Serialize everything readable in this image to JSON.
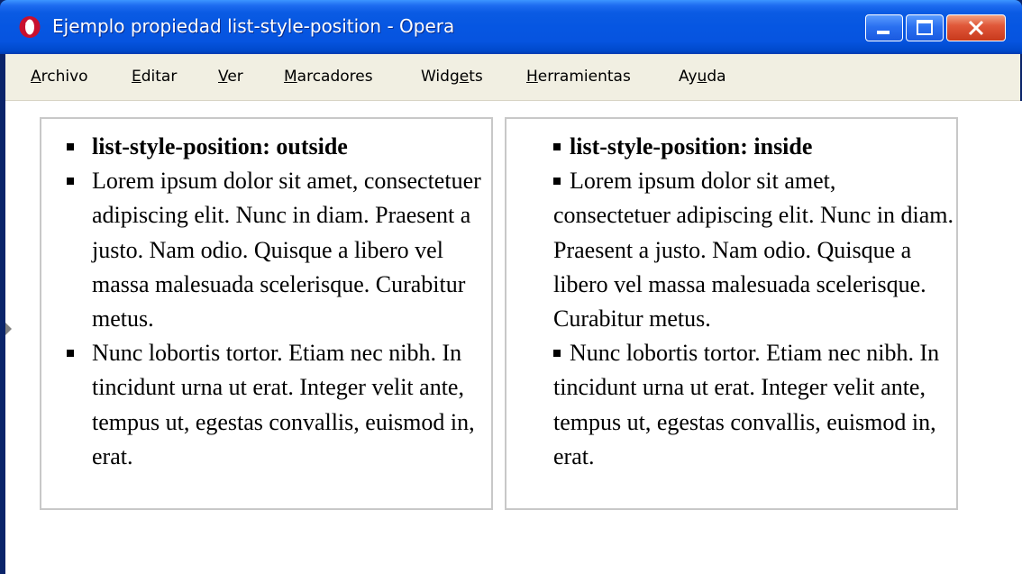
{
  "window": {
    "title": "Ejemplo propiedad list-style-position - Opera",
    "app_icon": "opera-icon",
    "controls": {
      "minimize": "minimize-icon",
      "maximize": "maximize-icon",
      "close": "close-icon"
    }
  },
  "menubar": {
    "items": [
      {
        "pre": "",
        "acc": "A",
        "post": "rchivo"
      },
      {
        "pre": "",
        "acc": "E",
        "post": "ditar"
      },
      {
        "pre": "",
        "acc": "V",
        "post": "er"
      },
      {
        "pre": "",
        "acc": "M",
        "post": "arcadores"
      },
      {
        "pre": "Widg",
        "acc": "e",
        "post": "ts"
      },
      {
        "pre": "",
        "acc": "H",
        "post": "erramientas"
      },
      {
        "pre": "Ay",
        "acc": "u",
        "post": "da"
      }
    ]
  },
  "examples": {
    "outside": {
      "heading": "list-style-position: outside",
      "item1": "Lorem ipsum dolor sit amet, consectetuer adipiscing elit. Nunc in diam. Praesent a justo. Nam odio. Quisque a libero vel massa malesuada scelerisque. Curabitur metus.",
      "item2": "Nunc lobortis tortor. Etiam nec nibh. In tincidunt urna ut erat. Integer velit ante, tempus ut, egestas convallis, euismod in, erat."
    },
    "inside": {
      "heading": "list-style-position: inside",
      "item1": "Lorem ipsum dolor sit amet, consectetuer adipiscing elit. Nunc in diam. Praesent a justo. Nam odio. Quisque a libero vel massa malesuada scelerisque. Curabitur metus.",
      "item2": "Nunc lobortis tortor. Etiam nec nibh. In tincidunt urna ut erat. Integer velit ante, tempus ut, egestas convallis, euismod in, erat."
    }
  },
  "colors": {
    "titlebar": "#0654df",
    "menubar": "#f1efe2",
    "box_border": "#c8c8c8",
    "close_button": "#e0583a"
  }
}
